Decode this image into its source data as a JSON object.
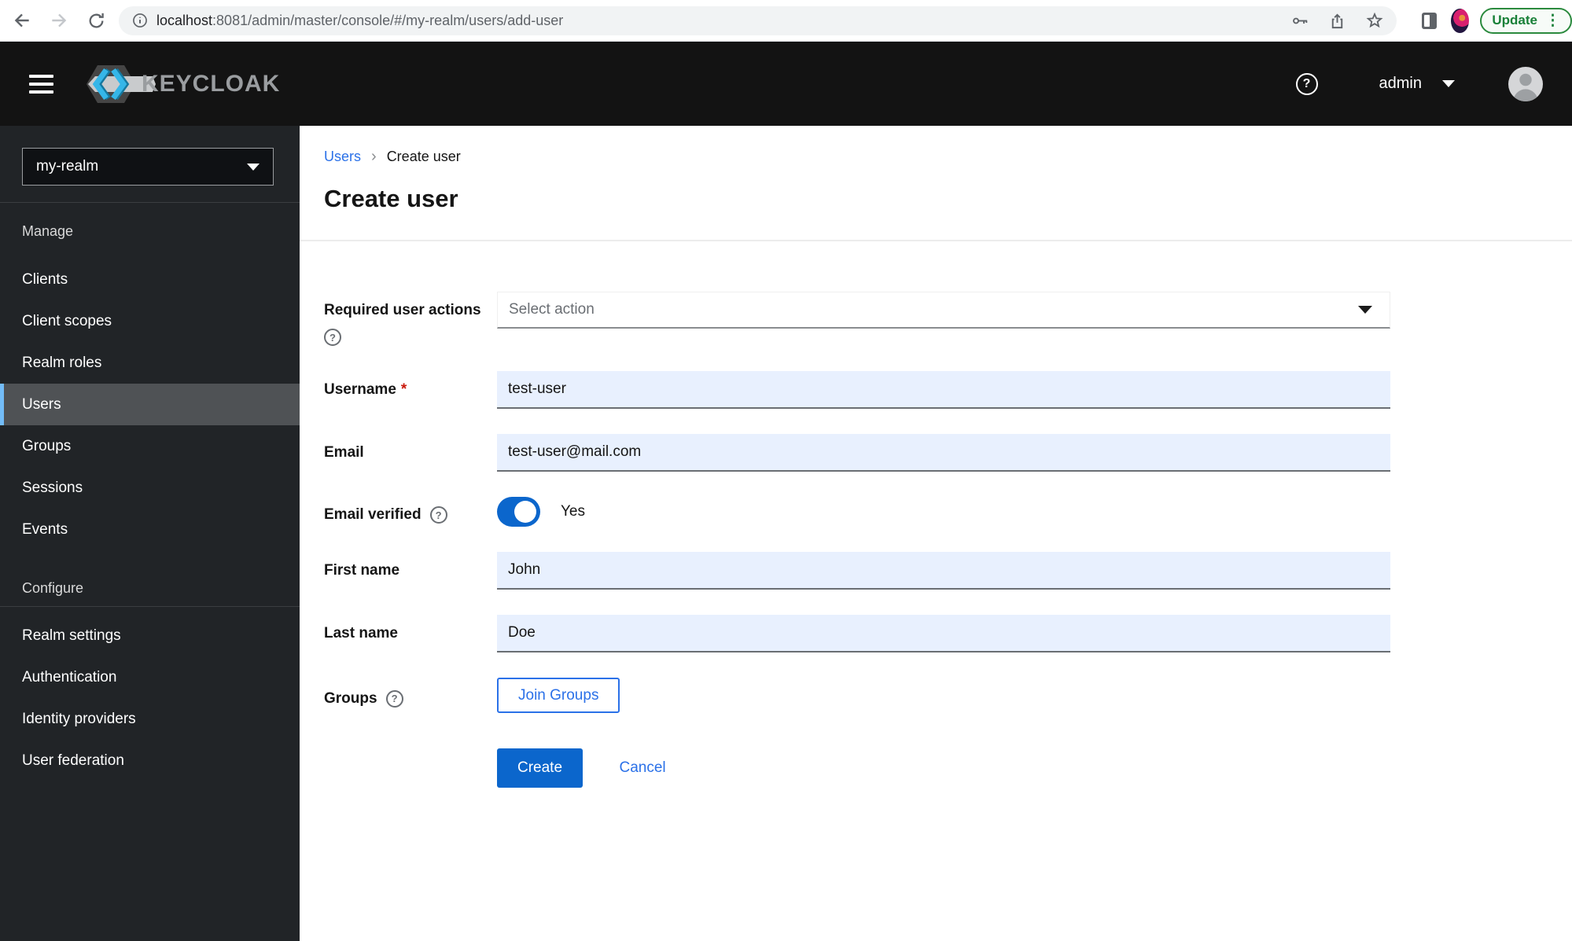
{
  "colors": {
    "accent_blue": "#0b66cc",
    "link_blue": "#2b71e8",
    "autofill_blue": "#e8f0fe",
    "masthead_black": "#131313",
    "sidebar_dark": "#212427",
    "active_item_border": "#73bcf7",
    "chrome_update_green": "#188038",
    "required_red": "#c9190b"
  },
  "icons": {
    "help": "?",
    "kebab": "⋮",
    "breadcrumb_sep": "›"
  },
  "browser": {
    "url_host": "localhost",
    "url_rest": ":8081/admin/master/console/#/my-realm/users/add-user",
    "update_label": "Update"
  },
  "masthead": {
    "brand": "KEYCLOAK",
    "username": "admin"
  },
  "sidebar": {
    "realm": "my-realm",
    "active_item": "Users",
    "sections": [
      {
        "title": "Manage",
        "items": [
          "Clients",
          "Client scopes",
          "Realm roles",
          "Users",
          "Groups",
          "Sessions",
          "Events"
        ]
      },
      {
        "title": "Configure",
        "items": [
          "Realm settings",
          "Authentication",
          "Identity providers",
          "User federation"
        ]
      }
    ]
  },
  "breadcrumb": {
    "parent": "Users",
    "current": "Create user"
  },
  "page": {
    "title": "Create user"
  },
  "form": {
    "required_actions": {
      "label": "Required user actions",
      "placeholder": "Select action"
    },
    "username": {
      "label": "Username",
      "required_marker": "*",
      "value": "test-user"
    },
    "email": {
      "label": "Email",
      "value": "test-user@mail.com"
    },
    "email_verified": {
      "label": "Email verified",
      "state": "Yes"
    },
    "first_name": {
      "label": "First name",
      "value": "John"
    },
    "last_name": {
      "label": "Last name",
      "value": "Doe"
    },
    "groups": {
      "label": "Groups",
      "button_label": "Join Groups"
    },
    "actions": {
      "create_label": "Create",
      "cancel_label": "Cancel"
    }
  }
}
